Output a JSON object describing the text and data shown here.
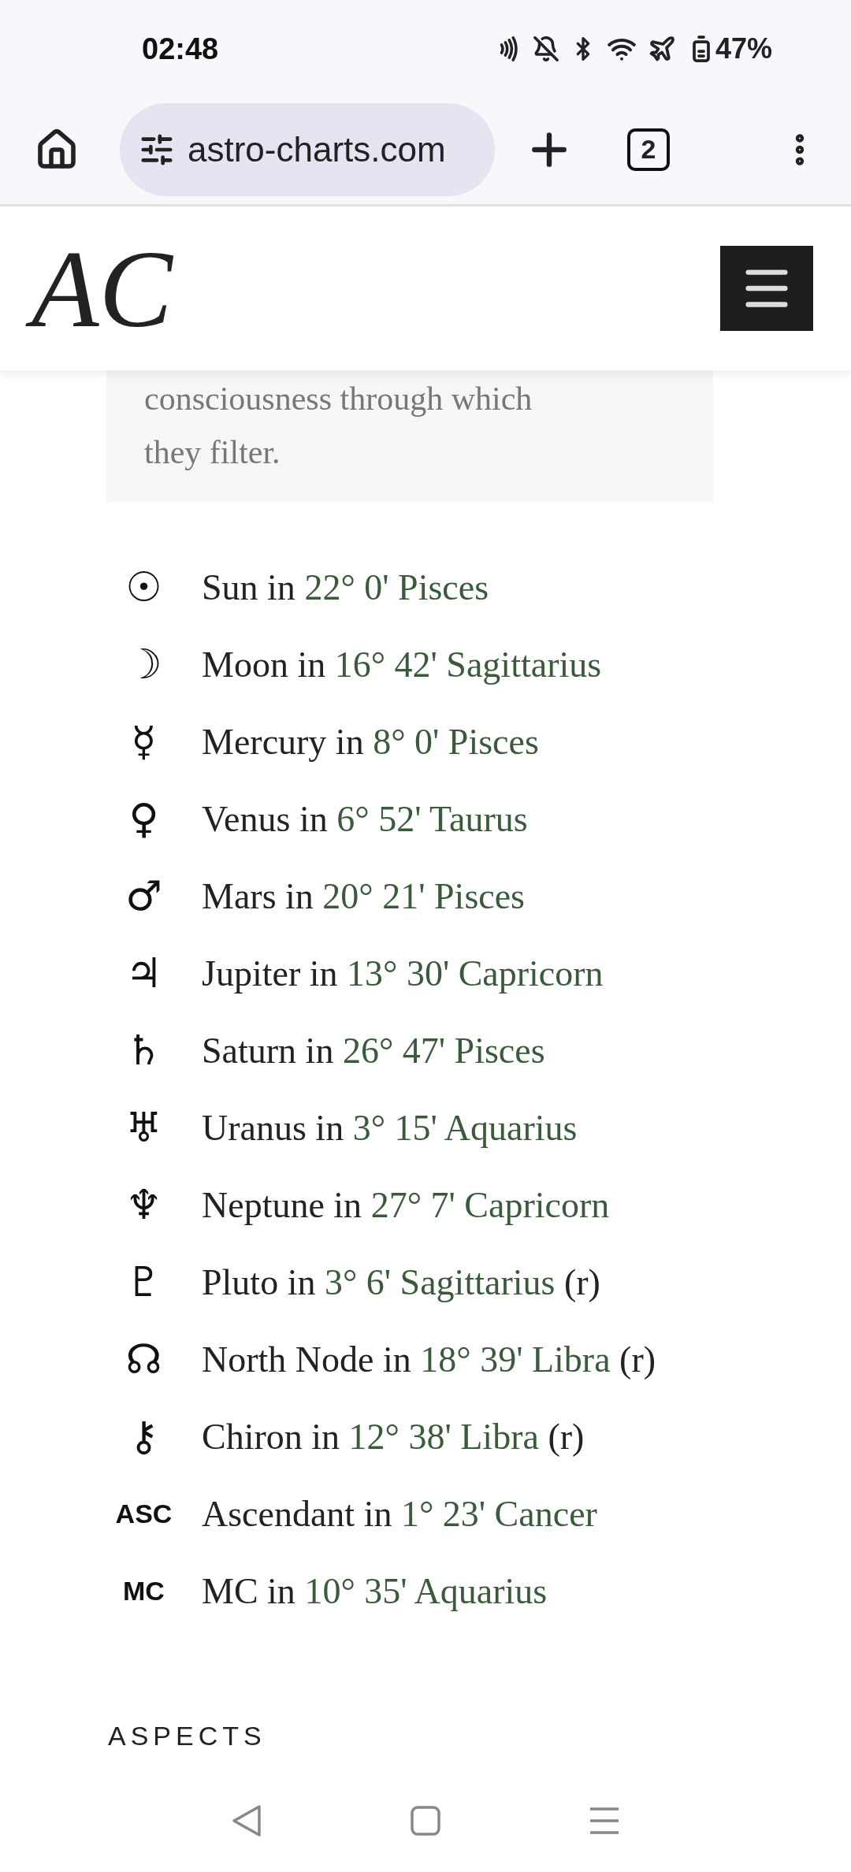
{
  "status_bar": {
    "time": "02:48",
    "battery": "47%"
  },
  "browser": {
    "url": "astro-charts.com",
    "tab_count": "2"
  },
  "header": {
    "logo": "AC"
  },
  "quote": {
    "lines": [
      "consciousness through which",
      "they filter."
    ]
  },
  "placements": [
    {
      "kind": "glyph",
      "symbol": "☉",
      "body": "Sun in",
      "position": "22° 0' Pisces"
    },
    {
      "kind": "glyph",
      "symbol": "☽",
      "body": "Moon in",
      "position": "16° 42' Sagittarius"
    },
    {
      "kind": "glyph",
      "symbol": "☿",
      "body": "Mercury in",
      "position": "8° 0' Pisces"
    },
    {
      "kind": "glyph",
      "symbol": "♀",
      "body": "Venus in",
      "position": "6° 52' Taurus"
    },
    {
      "kind": "glyph",
      "symbol": "♂",
      "body": "Mars in",
      "position": "20° 21' Pisces"
    },
    {
      "kind": "glyph",
      "symbol": "♃",
      "body": "Jupiter in",
      "position": "13° 30' Capricorn"
    },
    {
      "kind": "glyph",
      "symbol": "♄",
      "body": "Saturn in",
      "position": "26° 47' Pisces"
    },
    {
      "kind": "glyph",
      "symbol": "♅",
      "body": "Uranus in",
      "position": "3° 15' Aquarius"
    },
    {
      "kind": "glyph",
      "symbol": "♆",
      "body": "Neptune in",
      "position": "27° 7' Capricorn"
    },
    {
      "kind": "glyph",
      "symbol": "♇",
      "body": "Pluto in",
      "position": "3° 6' Sagittarius",
      "suffix": "(r)"
    },
    {
      "kind": "glyph",
      "symbol": "☊",
      "body": "North Node in",
      "position": "18° 39' Libra",
      "suffix": "(r)"
    },
    {
      "kind": "glyph",
      "symbol": "⚷",
      "body": "Chiron in",
      "position": "12° 38' Libra",
      "suffix": "(r)"
    },
    {
      "kind": "abbr",
      "symbol": "ASC",
      "body": "Ascendant in",
      "position": "1° 23' Cancer"
    },
    {
      "kind": "abbr",
      "symbol": "MC",
      "body": "MC in",
      "position": "10° 35' Aquarius"
    }
  ],
  "section_heading": "ASPECTS"
}
